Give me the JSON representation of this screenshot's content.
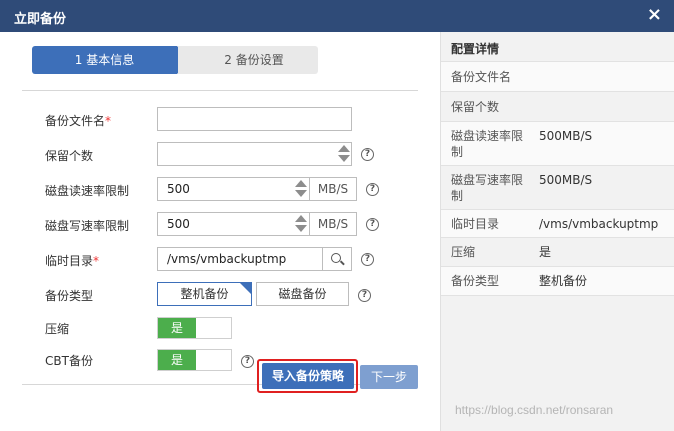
{
  "dialog": {
    "title": "立即备份",
    "close_label": "×"
  },
  "steps": [
    {
      "label": "1 基本信息",
      "active": true
    },
    {
      "label": "2 备份设置",
      "active": false
    }
  ],
  "form": {
    "filename": {
      "label": "备份文件名",
      "required": "*",
      "value": ""
    },
    "keep_count": {
      "label": "保留个数",
      "value": ""
    },
    "read_limit": {
      "label": "磁盘读速率限制",
      "value": "500",
      "unit": "MB/S"
    },
    "write_limit": {
      "label": "磁盘写速率限制",
      "value": "500",
      "unit": "MB/S"
    },
    "temp_dir": {
      "label": "临时目录",
      "required": "*",
      "value": "/vms/vmbackuptmp"
    },
    "backup_type": {
      "label": "备份类型",
      "options": [
        "整机备份",
        "磁盘备份"
      ],
      "selected": "整机备份"
    },
    "compress": {
      "label": "压缩",
      "toggle_label": "是",
      "on": true
    },
    "cbt": {
      "label": "CBT备份",
      "toggle_label": "是",
      "on": true
    },
    "help_glyph": "?"
  },
  "buttons": {
    "import_policy": "导入备份策略",
    "next": "下一步"
  },
  "details": {
    "header": "配置详情",
    "rows": [
      {
        "key": "备份文件名",
        "value": ""
      },
      {
        "key": "保留个数",
        "value": ""
      },
      {
        "key": "磁盘读速率限制",
        "value": "500MB/S"
      },
      {
        "key": "磁盘写速率限制",
        "value": "500MB/S"
      },
      {
        "key": "临时目录",
        "value": "/vms/vmbackuptmp"
      },
      {
        "key": "压缩",
        "value": "是"
      },
      {
        "key": "备份类型",
        "value": "整机备份"
      }
    ]
  },
  "watermark": "https://blog.csdn.net/ronsaran",
  "colors": {
    "titlebar": "#2f4b78",
    "accent": "#3d6fb9",
    "toggle_on": "#4cae4c",
    "required": "#e33333",
    "highlight": "#e02020"
  }
}
